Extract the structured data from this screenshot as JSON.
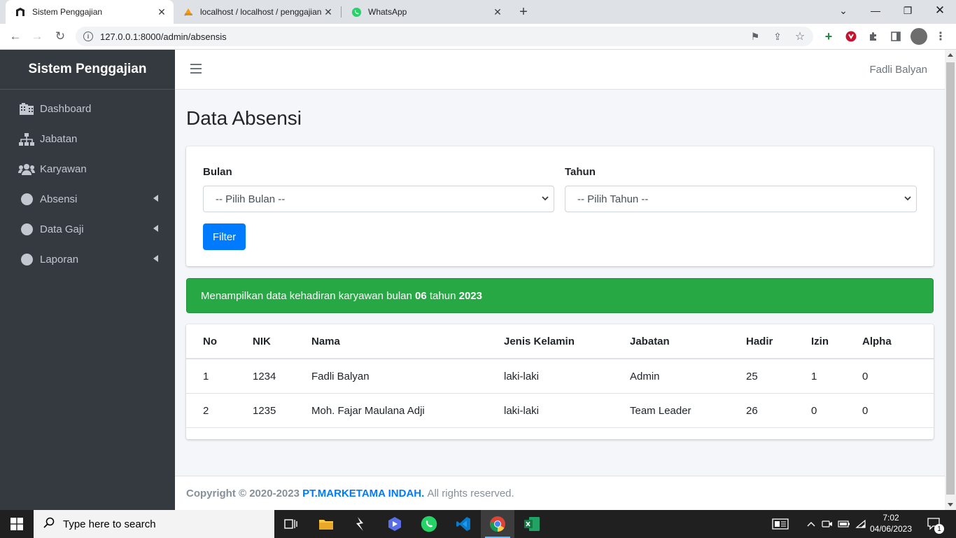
{
  "browser": {
    "tabs": [
      {
        "title": "Sistem Penggajian",
        "active": true
      },
      {
        "title": "localhost / localhost / penggajian",
        "active": false
      },
      {
        "title": "WhatsApp",
        "active": false
      }
    ],
    "url": "127.0.0.1:8000/admin/absensis"
  },
  "sidebar": {
    "brand": "Sistem Penggajian",
    "items": [
      {
        "label": "Dashboard",
        "icon": "building-icon"
      },
      {
        "label": "Jabatan",
        "icon": "sitemap-icon"
      },
      {
        "label": "Karyawan",
        "icon": "users-icon"
      },
      {
        "label": "Absensi",
        "icon": "circle-icon"
      },
      {
        "label": "Data Gaji",
        "icon": "circle-icon"
      },
      {
        "label": "Laporan",
        "icon": "circle-icon"
      }
    ]
  },
  "topnav": {
    "user": "Fadli Balyan"
  },
  "main": {
    "title": "Data Absensi",
    "filter": {
      "month_label": "Bulan",
      "month_value": "-- Pilih Bulan --",
      "year_label": "Tahun",
      "year_value": "-- Pilih Tahun --",
      "button": "Filter"
    },
    "alert": {
      "prefix": "Menampilkan data kehadiran karyawan bulan",
      "month": "06",
      "middle": "tahun",
      "year": "2023"
    },
    "table": {
      "headers": [
        "No",
        "NIK",
        "Nama",
        "Jenis Kelamin",
        "Jabatan",
        "Hadir",
        "Izin",
        "Alpha"
      ],
      "rows": [
        [
          "1",
          "1234",
          "Fadli Balyan",
          "laki-laki",
          "Admin",
          "25",
          "1",
          "0"
        ],
        [
          "2",
          "1235",
          "Moh. Fajar Maulana Adji",
          "laki-laki",
          "Team Leader",
          "26",
          "0",
          "0"
        ]
      ]
    }
  },
  "footer": {
    "copyright": "Copyright © 2020-2023",
    "company": "PT.MARKETAMA INDAH.",
    "rights": "All rights reserved."
  },
  "taskbar": {
    "search_placeholder": "Type here to search",
    "time": "7:02",
    "date": "04/06/2023",
    "notification_count": "1"
  },
  "colors": {
    "sidebar_bg": "#343a40",
    "primary": "#007bff",
    "success": "#28a745"
  }
}
